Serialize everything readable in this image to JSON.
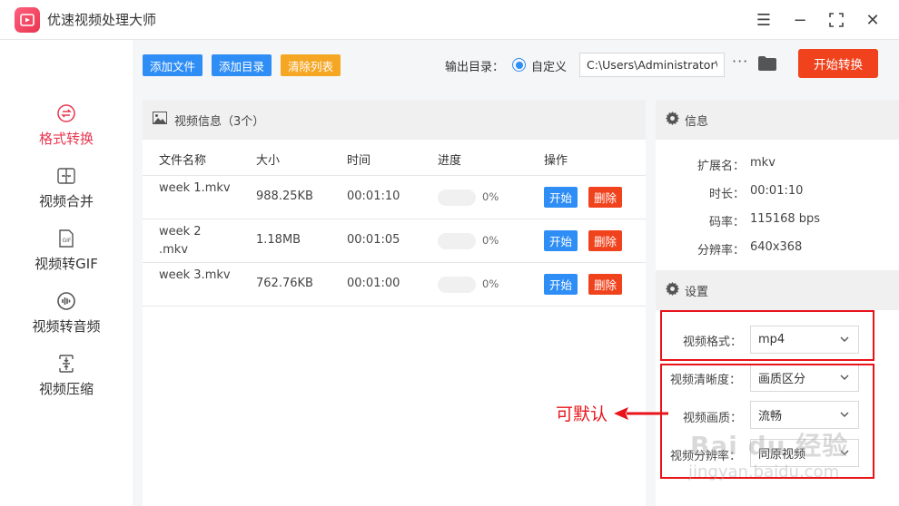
{
  "app": {
    "title": "优速视频处理大师"
  },
  "window_controls": {
    "menu": "☰",
    "minimize": "−",
    "maximize": "⛶",
    "close": "✕"
  },
  "sidebar": {
    "items": [
      {
        "label": "格式转换",
        "icon": "format-convert-icon",
        "active": true
      },
      {
        "label": "视频合并",
        "icon": "merge-icon",
        "active": false
      },
      {
        "label": "视频转GIF",
        "icon": "gif-icon",
        "active": false
      },
      {
        "label": "视频转音频",
        "icon": "audio-icon",
        "active": false
      },
      {
        "label": "视频压缩",
        "icon": "compress-icon",
        "active": false
      }
    ]
  },
  "toolbar": {
    "add_file": "添加文件",
    "add_dir": "添加目录",
    "clear_list": "清除列表",
    "output_label": "输出目录：",
    "output_option": "自定义",
    "output_path": "C:\\Users\\Administrator\\",
    "more": "···",
    "start_all": "开始转换"
  },
  "file_panel": {
    "title": "视频信息（3个）",
    "columns": [
      "文件名称",
      "大小",
      "时间",
      "进度",
      "操作"
    ],
    "rows": [
      {
        "name": "week 1.mkv",
        "size": "988.25KB",
        "time": "00:01:10",
        "progress": "0%",
        "progress_value": 0,
        "start": "开始",
        "delete": "删除"
      },
      {
        "name": "week 2 .mkv",
        "size": "1.18MB",
        "time": "00:01:05",
        "progress": "0%",
        "progress_value": 0,
        "start": "开始",
        "delete": "删除"
      },
      {
        "name": "week 3.mkv",
        "size": "762.76KB",
        "time": "00:01:00",
        "progress": "0%",
        "progress_value": 0,
        "start": "开始",
        "delete": "删除"
      }
    ]
  },
  "info": {
    "title": "信息",
    "ext_k": "扩展名：",
    "ext_v": "mkv",
    "dur_k": "时长：",
    "dur_v": "00:01:10",
    "bitrate_k": "码率：",
    "bitrate_v": "115168 bps",
    "res_k": "分辨率：",
    "res_v": "640x368"
  },
  "settings": {
    "title": "设置",
    "format_label": "视频格式：",
    "format_value": "mp4",
    "clarity_label": "视频清晰度：",
    "clarity_value": "画质区分",
    "quality_label": "视频画质：",
    "quality_value": "流畅",
    "resolution_label": "视频分辨率：",
    "resolution_value": "同原视频"
  },
  "annotation": {
    "text": "可默认"
  },
  "watermark": {
    "brand": "Bai du 经验",
    "url": "jingyan.baidu.com"
  },
  "colors": {
    "accent_red": "#e8364f",
    "primary_blue": "#2f8ef5",
    "danger": "#f0421c",
    "warning": "#f5a623",
    "annotation": "#e8141a"
  }
}
